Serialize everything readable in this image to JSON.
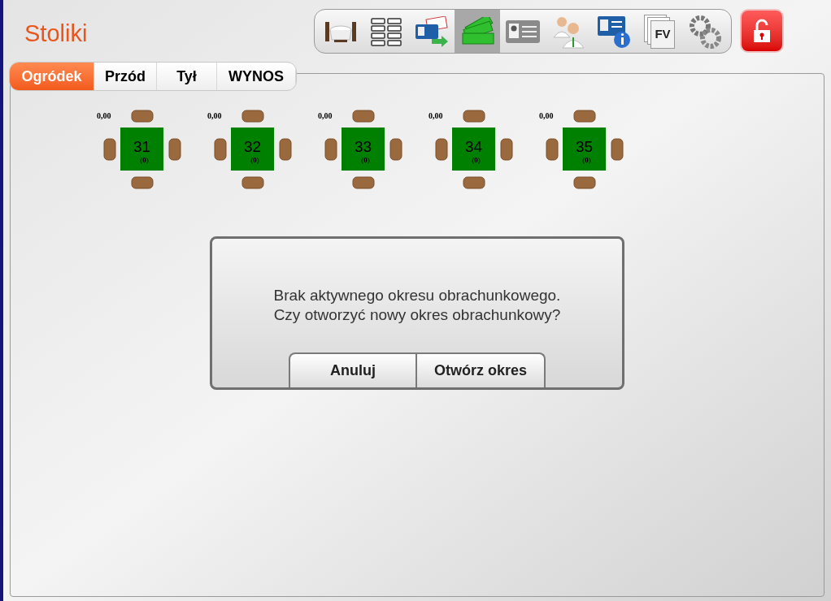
{
  "header": {
    "title": "Stoliki"
  },
  "toolbar": [
    {
      "kind": "dining",
      "selected": false
    },
    {
      "kind": "grid",
      "selected": false
    },
    {
      "kind": "discount",
      "selected": false
    },
    {
      "kind": "money",
      "selected": true
    },
    {
      "kind": "card",
      "selected": false
    },
    {
      "kind": "people",
      "selected": false
    },
    {
      "kind": "info",
      "selected": false
    },
    {
      "kind": "invoice",
      "selected": false,
      "label": "FV"
    },
    {
      "kind": "gears",
      "selected": false
    }
  ],
  "lock_button": {
    "kind": "lock"
  },
  "tabs": [
    {
      "label": "Ogródek",
      "selected": true
    },
    {
      "label": "Przód",
      "selected": false
    },
    {
      "label": "Tył",
      "selected": false
    },
    {
      "label": "WYNOS",
      "selected": false
    }
  ],
  "tables": [
    {
      "amount": "0,00",
      "number": "31",
      "guests": "(0)"
    },
    {
      "amount": "0,00",
      "number": "32",
      "guests": "(0)"
    },
    {
      "amount": "0,00",
      "number": "33",
      "guests": "(0)"
    },
    {
      "amount": "0,00",
      "number": "34",
      "guests": "(0)"
    },
    {
      "amount": "0,00",
      "number": "35",
      "guests": "(0)"
    }
  ],
  "dialog": {
    "message": [
      "Brak aktywnego okresu obrachunkowego.",
      "Czy otworzyć nowy okres obrachunkowy?"
    ],
    "buttons": [
      "Anuluj",
      "Otwórz okres"
    ]
  }
}
